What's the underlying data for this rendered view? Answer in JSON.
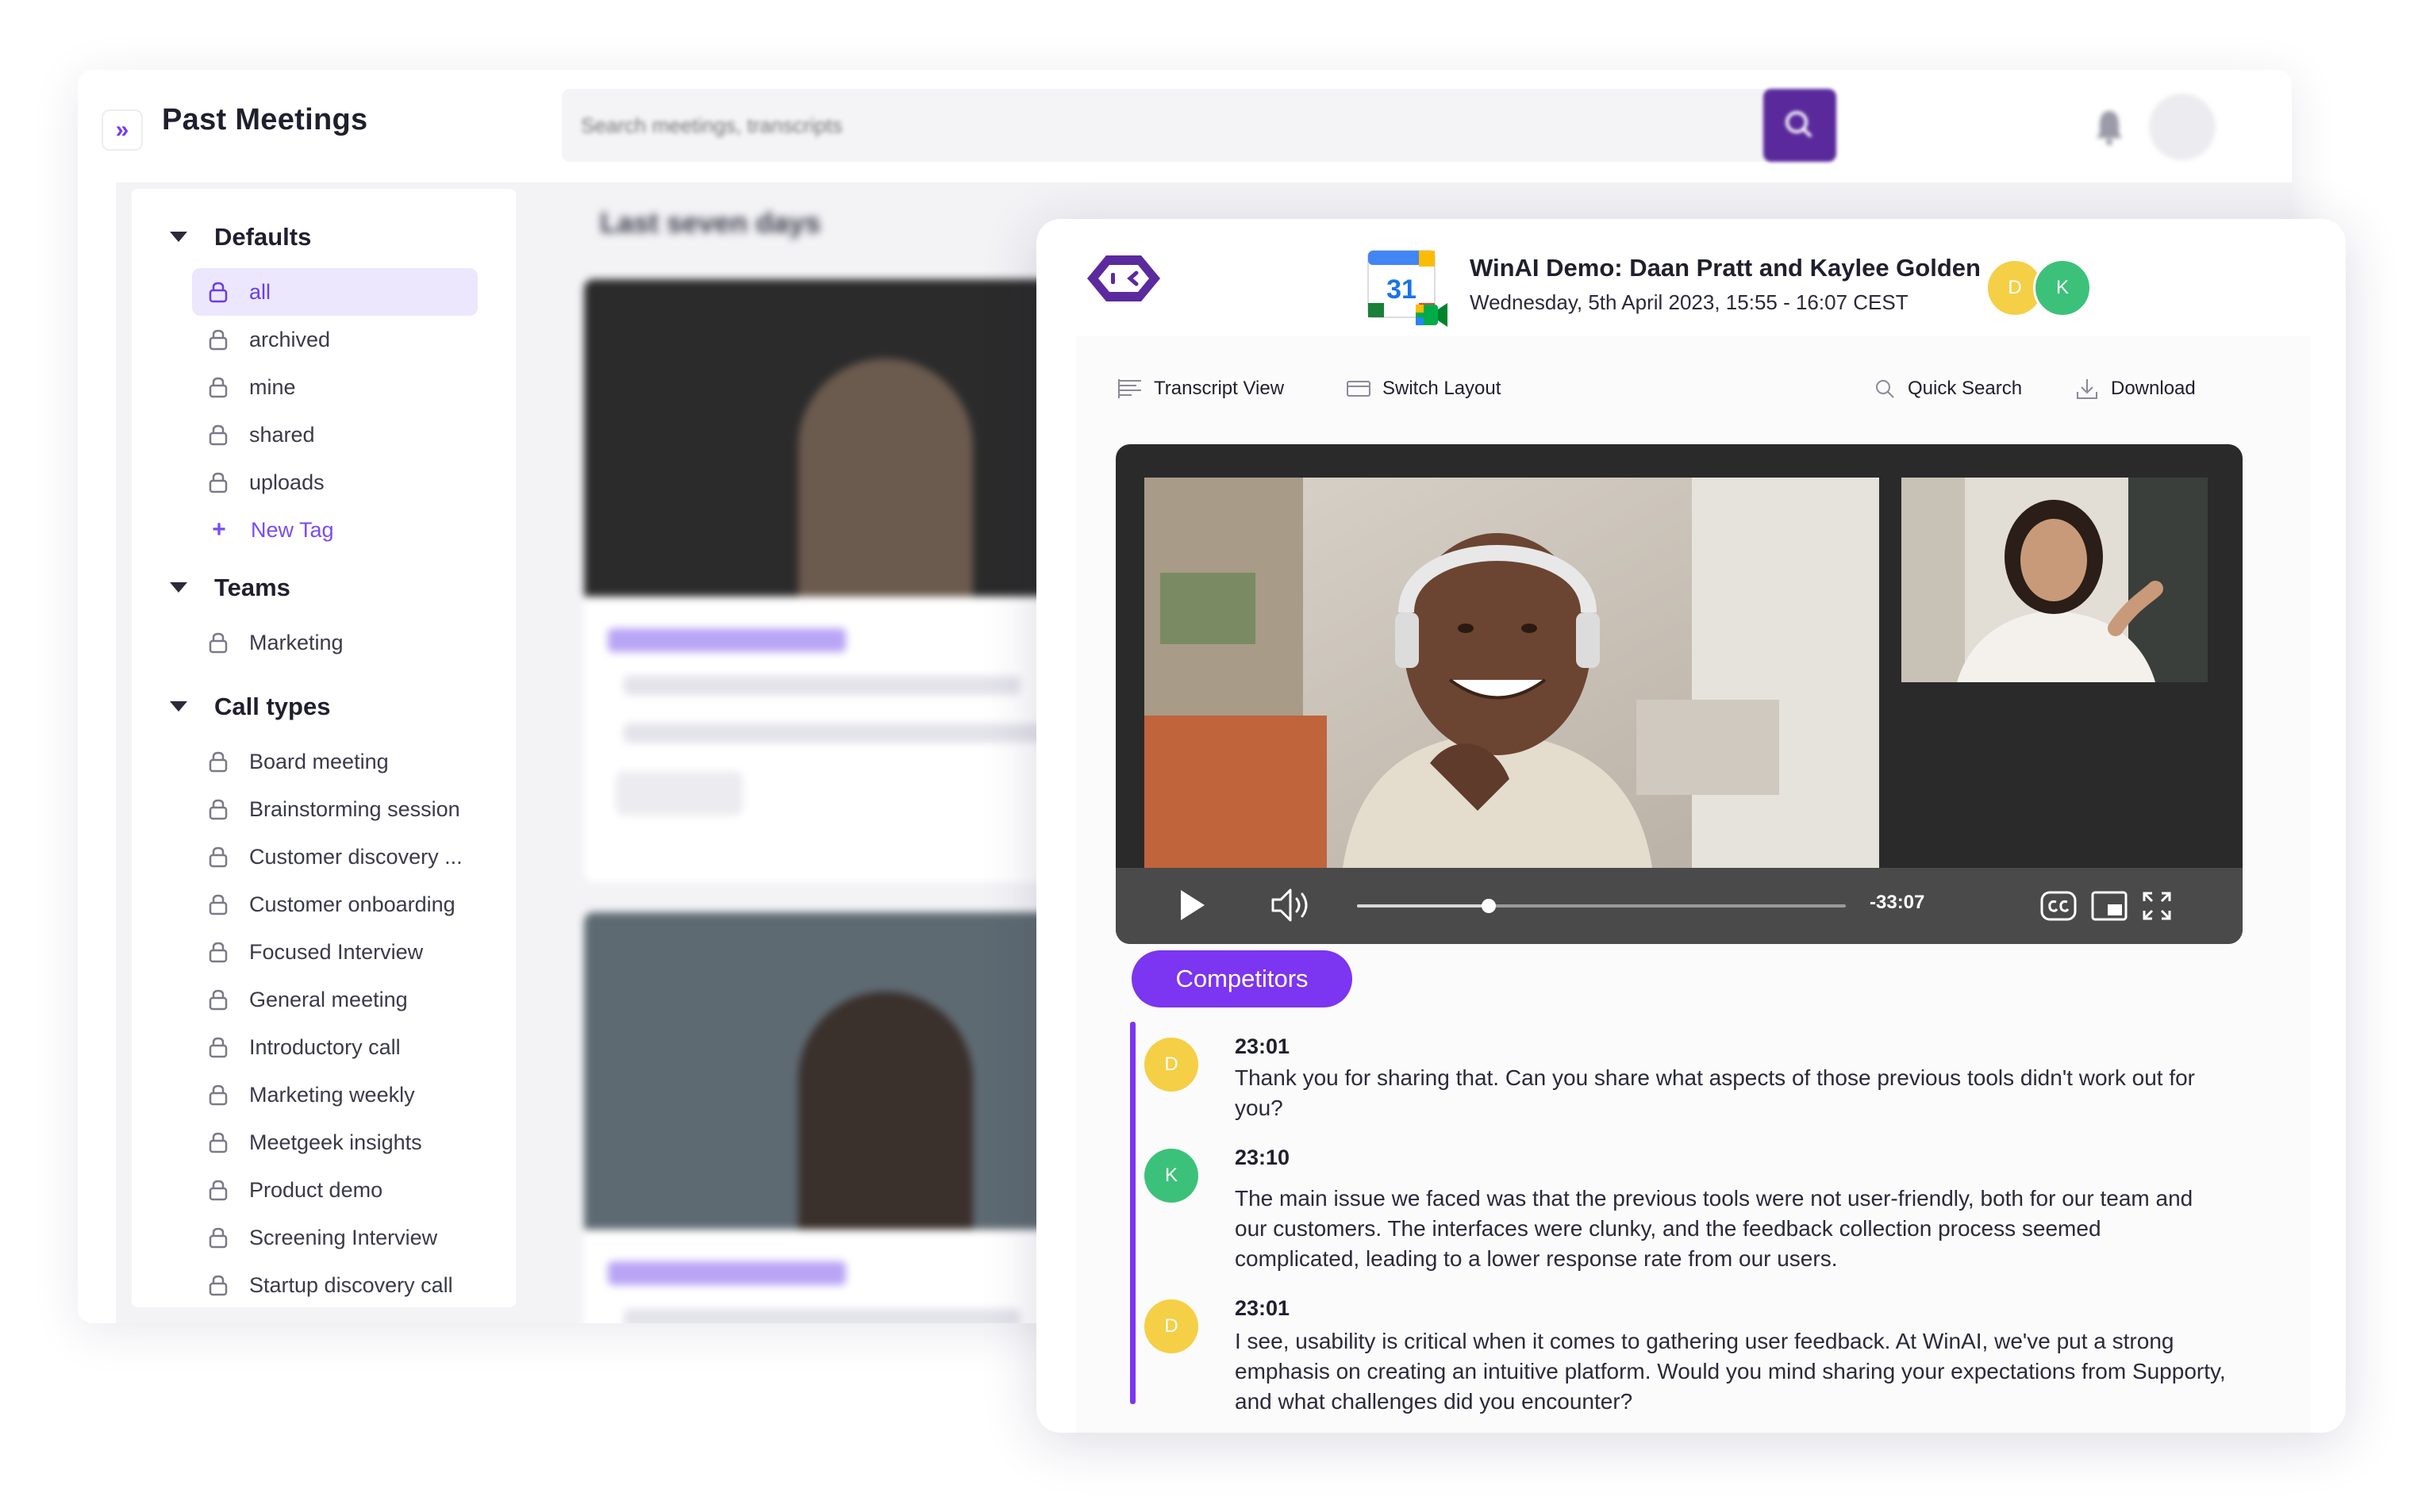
{
  "back": {
    "title": "Past Meetings",
    "search_placeholder": "Search meetings, transcripts",
    "feed_heading": "Last seven days",
    "sections": [
      {
        "title": "Defaults"
      },
      {
        "title": "Teams"
      },
      {
        "title": "Call types"
      }
    ],
    "defaults": [
      "all",
      "archived",
      "mine",
      "shared",
      "uploads"
    ],
    "new_tag": "New Tag",
    "teams": [
      "Marketing"
    ],
    "call_types": [
      "Board meeting",
      "Brainstorming session",
      "Customer discovery ...",
      "Customer onboarding",
      "Focused Interview",
      "General meeting",
      "Introductory call",
      "Marketing weekly",
      "Meetgeek insights",
      "Product demo",
      "Screening Interview",
      "Startup discovery call"
    ]
  },
  "meeting": {
    "title": "WinAI Demo: Daan Pratt and Kaylee Golden",
    "datetime": "Wednesday, 5th April 2023, 15:55 - 16:07 CEST",
    "calendar_day": "31",
    "participants": [
      {
        "initial": "D",
        "color": "#f5cf45"
      },
      {
        "initial": "K",
        "color": "#3cc17a"
      }
    ]
  },
  "toolbar": {
    "transcript_view": "Transcript View",
    "switch_layout": "Switch Layout",
    "quick_search": "Quick Search",
    "download": "Download"
  },
  "player": {
    "time_remaining": "-33:07",
    "progress_fraction": 0.27
  },
  "topic": "Competitors",
  "transcript": [
    {
      "initial": "D",
      "color": "#f5cf45",
      "time": "23:01",
      "text": "Thank you for sharing that. Can you share what aspects of those previous tools didn't work out for you?"
    },
    {
      "initial": "K",
      "color": "#3cc17a",
      "time": "23:10",
      "text": "The main issue we faced was that the previous tools were not user-friendly, both for our team and our customers. The interfaces were clunky, and the feedback collection process seemed complicated, leading to a lower response rate from our users."
    },
    {
      "initial": "D",
      "color": "#f5cf45",
      "time": "23:01",
      "text": "I see, usability is critical when it comes to gathering user feedback. At WinAI, we've put a strong emphasis on creating an intuitive platform. Would you mind sharing your expectations from Supporty, and what challenges did you encounter?"
    }
  ],
  "colors": {
    "accent": "#7c35f0",
    "accent_soft": "#ece7fd",
    "search_button": "#5a2a9c"
  }
}
